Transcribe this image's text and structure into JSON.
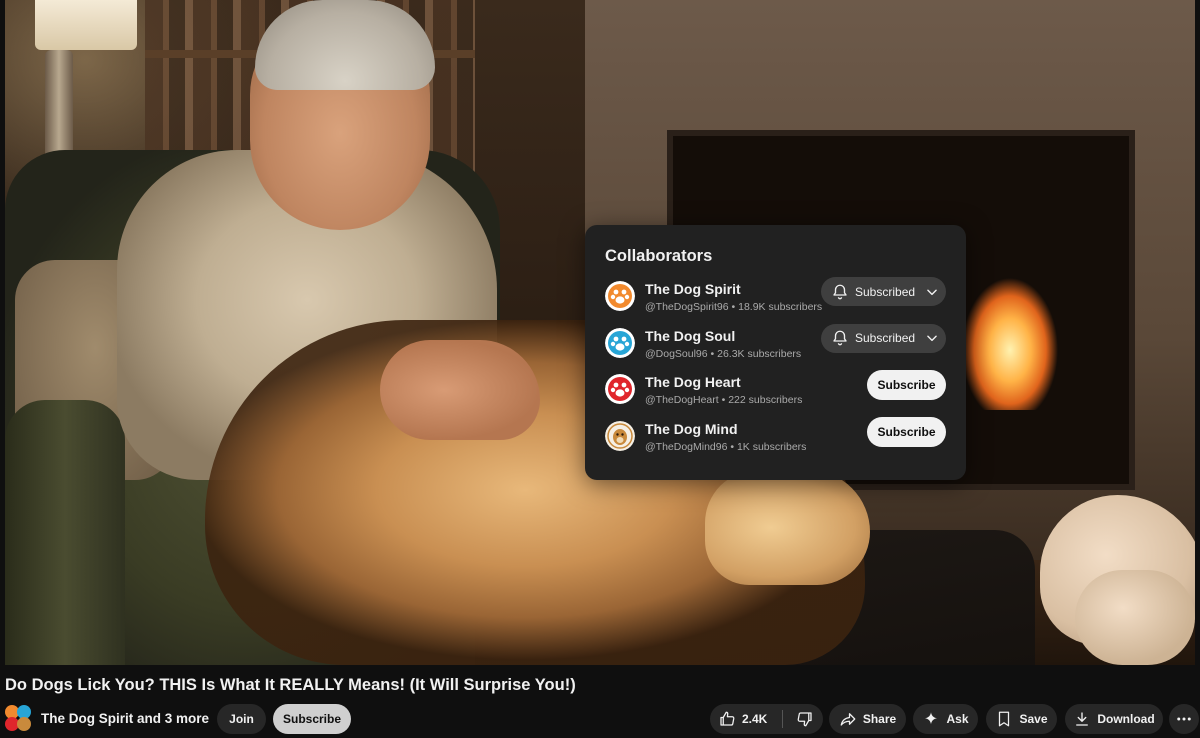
{
  "collaborators": {
    "title": "Collaborators",
    "items": [
      {
        "name": "The Dog Spirit",
        "meta": "@TheDogSpirit96 • 18.9K subscribers",
        "button": "Subscribed",
        "subscribed": true,
        "color": "#f28a2e"
      },
      {
        "name": "The Dog Soul",
        "meta": "@DogSoul96 • 26.3K subscribers",
        "button": "Subscribed",
        "subscribed": true,
        "color": "#27a5d6"
      },
      {
        "name": "The Dog Heart",
        "meta": "@TheDogHeart • 222 subscribers",
        "button": "Subscribe",
        "subscribed": false,
        "color": "#e0262c"
      },
      {
        "name": "The Dog Mind",
        "meta": "@TheDogMind96 • 1K subscribers",
        "button": "Subscribe",
        "subscribed": false,
        "color": "#c98a3c"
      }
    ]
  },
  "video": {
    "title": "Do Dogs Lick You? THIS Is What It REALLY Means! (It Will Surprise You!)",
    "owner": "The Dog Spirit and 3 more"
  },
  "actions": {
    "join": "Join",
    "subscribe": "Subscribe",
    "likes": "2.4K",
    "share": "Share",
    "ask": "Ask",
    "save": "Save",
    "download": "Download"
  },
  "icons": [
    "bell-icon",
    "chevron-down-icon",
    "like-icon",
    "dislike-icon",
    "share-icon",
    "sparkle-icon",
    "bookmark-icon",
    "download-icon",
    "more-icon"
  ]
}
